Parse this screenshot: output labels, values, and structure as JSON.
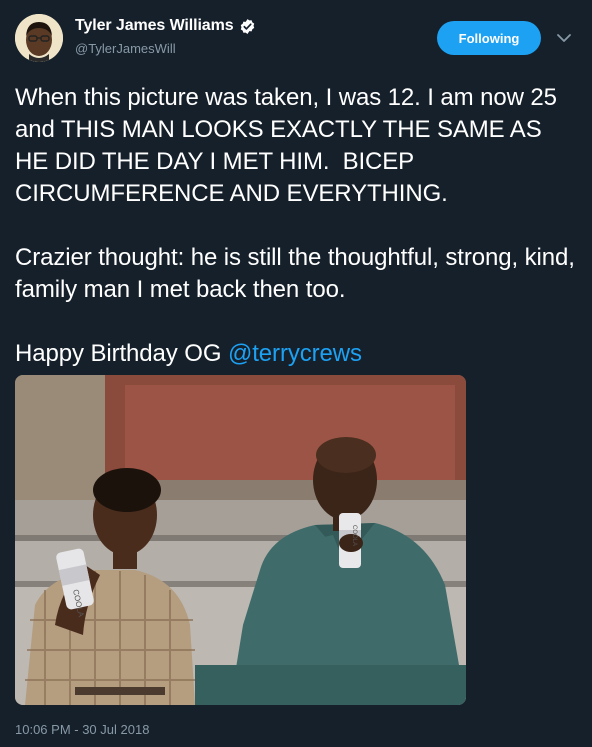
{
  "author": {
    "display_name": "Tyler James Williams",
    "handle": "@TylerJamesWill",
    "verified_icon": "verified-badge-icon",
    "avatar_icon": "avatar"
  },
  "follow_button": {
    "label": "Following"
  },
  "menu": {
    "icon": "chevron-down-icon"
  },
  "tweet": {
    "paragraph_1": "When this picture was taken, I was 12. I am now 25 and THIS MAN LOOKS EXACTLY THE SAME AS HE DID THE DAY I MET HIM.  BICEP CIRCUMFERENCE AND EVERYTHING.",
    "paragraph_2": "Crazier thought: he is still the thoughtful, strong, kind, family man I met back then too.",
    "paragraph_3_prefix": "Happy Birthday OG ",
    "mention": "@terrycrews"
  },
  "media": {
    "kind": "photo",
    "can_label_left": "COOLA",
    "can_label_right": "COOLA"
  },
  "timestamp": "10:06 PM - 30 Jul 2018",
  "colors": {
    "background": "#15202b",
    "accent": "#1da1f2",
    "secondary_text": "#8899a6"
  }
}
